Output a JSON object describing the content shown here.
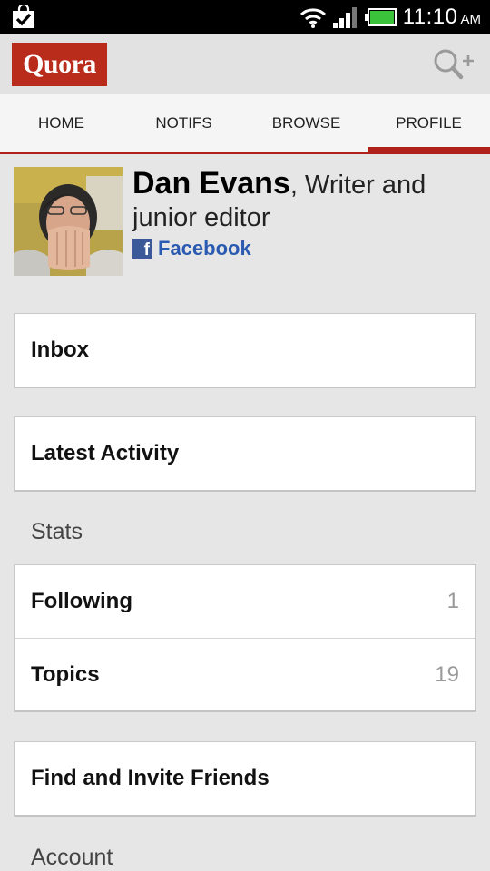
{
  "status_bar": {
    "time": "11:10",
    "ampm": "AM"
  },
  "app": {
    "logo_text": "Quora"
  },
  "tabs": [
    {
      "label": "HOME",
      "active": false
    },
    {
      "label": "NOTIFS",
      "active": false
    },
    {
      "label": "BROWSE",
      "active": false
    },
    {
      "label": "PROFILE",
      "active": true
    }
  ],
  "profile": {
    "name": "Dan Evans",
    "credential": ", Writer and junior editor",
    "link_label": "Facebook"
  },
  "cards": {
    "inbox": "Inbox",
    "latest_activity": "Latest Activity"
  },
  "stats": {
    "heading": "Stats",
    "rows": [
      {
        "label": "Following",
        "count": "1"
      },
      {
        "label": "Topics",
        "count": "19"
      }
    ]
  },
  "invite": "Find and Invite Friends",
  "account_heading": "Account",
  "colors": {
    "brand": "#b92b1b",
    "accent": "#b0211a",
    "facebook": "#3b5998"
  }
}
